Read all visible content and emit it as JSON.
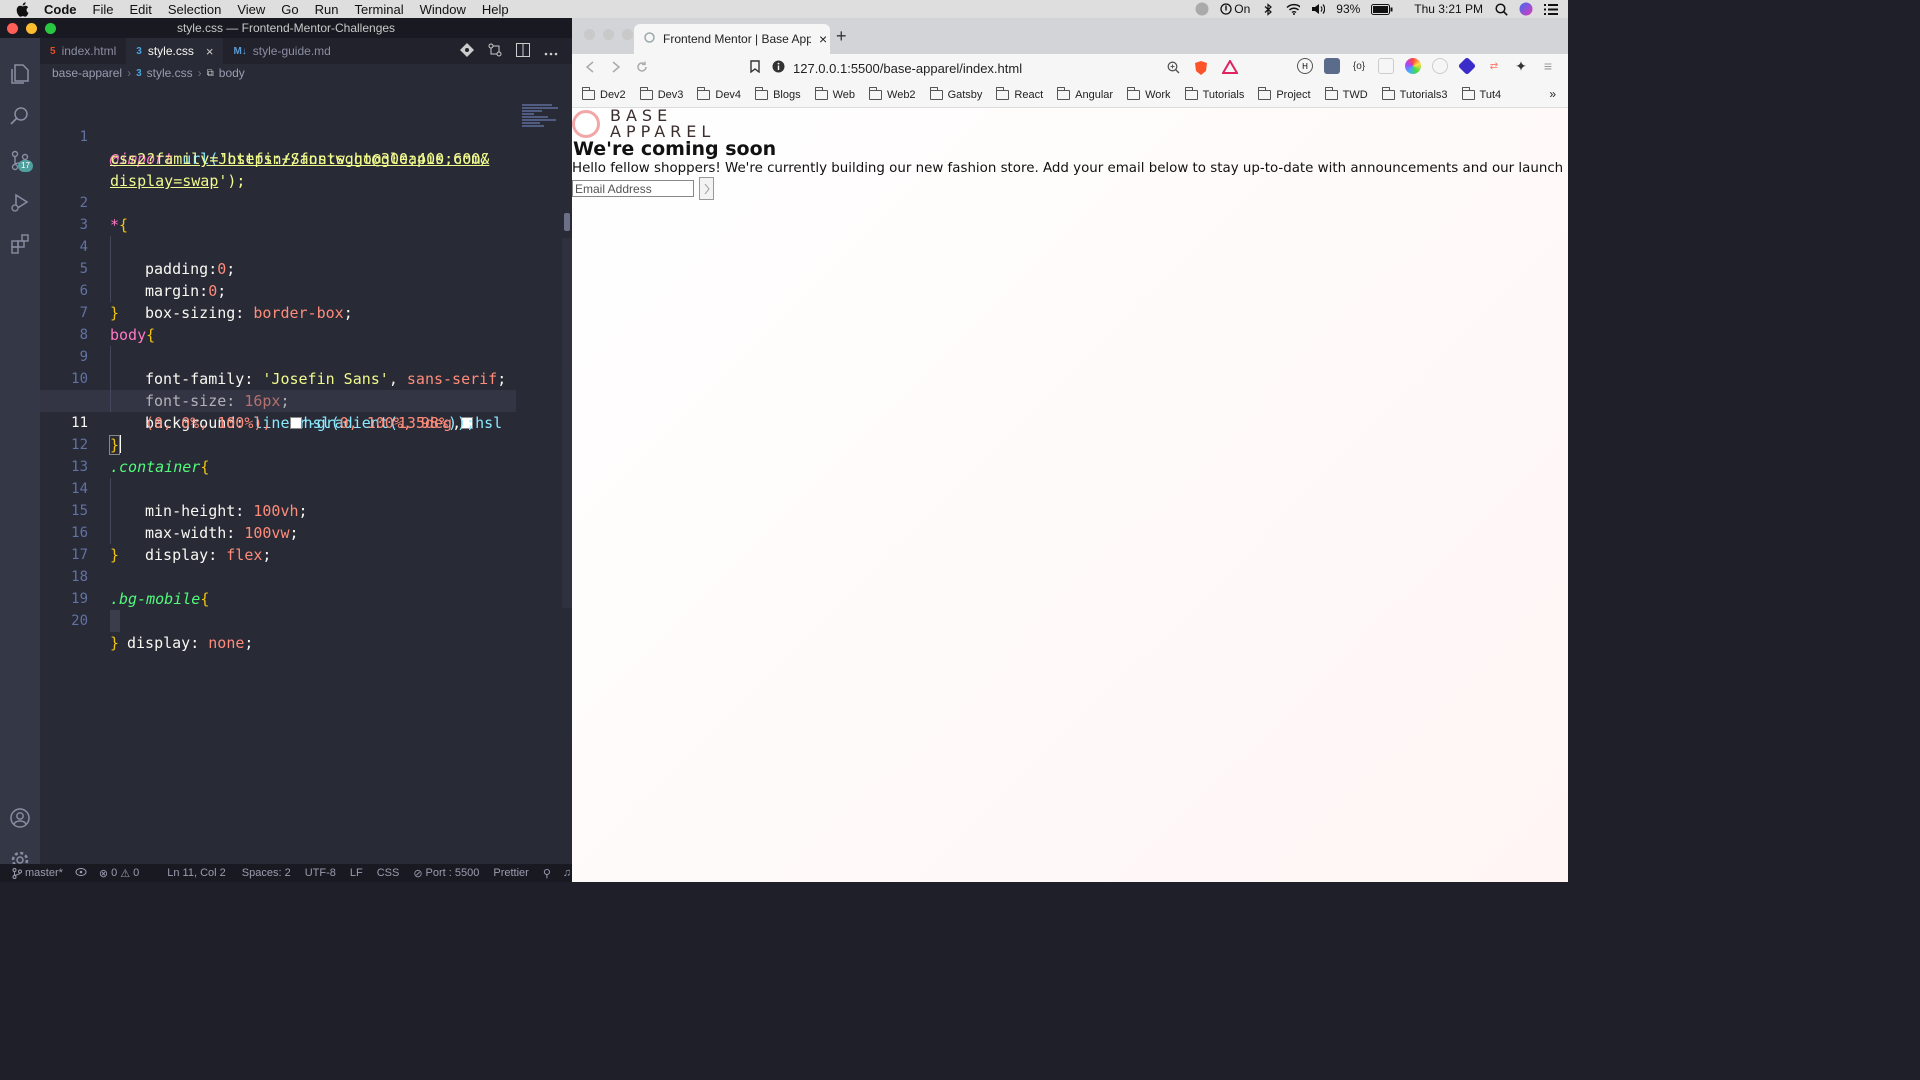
{
  "menubar": {
    "items": [
      "Code",
      "File",
      "Edit",
      "Selection",
      "View",
      "Go",
      "Run",
      "Terminal",
      "Window",
      "Help"
    ],
    "focus_label": "On",
    "battery": "93%",
    "clock": "Thu 3:21 PM"
  },
  "vscode": {
    "window_title": "style.css — Frontend-Mentor-Challenges",
    "scm_badge": "17",
    "tabs": [
      {
        "label": "index.html",
        "type": "html"
      },
      {
        "label": "style.css",
        "type": "css",
        "active": true
      },
      {
        "label": "style-guide.md",
        "type": "md"
      }
    ],
    "breadcrumb": [
      "base-apparel",
      "style.css",
      "body"
    ],
    "line_numbers": [
      "1",
      "2",
      "3",
      "4",
      "5",
      "6",
      "7",
      "8",
      "9",
      "10",
      "11",
      "12",
      "13",
      "14",
      "15",
      "16",
      "17",
      "18",
      "19",
      "20"
    ],
    "code": {
      "l1a_kw": "@import",
      "l1a_fn": "url(",
      "l1a_q": "'",
      "l1a_url": "https://fonts.googleapis.com/",
      "l1b_url": "css2?family=Josefin+Sans:wght@300;400;600&",
      "l1c_url": "display=swap",
      "l1c_end": "');",
      "l2_sel": "*",
      "l3_prop": "padding:",
      "l3_val": "0",
      "l4_prop": "margin:",
      "l4_val": "0",
      "l5_prop": "box-sizing: ",
      "l5_val": "border-box",
      "l7_sel": "body",
      "l8_prop": "font-family: ",
      "l8_str": "'Josefin Sans'",
      "l8_val": "sans-serif",
      "l9_prop": "font-size: ",
      "l9_val": "16px",
      "l10_prop": "background: ",
      "l10_fn": "linear-gradient(",
      "l10_deg": "135deg",
      "l10_hsl": "hsl",
      "l10b_args": "(0, 0%, 100%),",
      "l10b_hsl2": "hsl(",
      "l10b_args2": "0, 100%, 98%",
      "l10b_end": "));",
      "l12_sel": ".container",
      "l13_prop": "min-height: ",
      "l13_val": "100vh",
      "l14_prop": "max-width: ",
      "l14_val": "100vw",
      "l15_prop": "display: ",
      "l15_val": "flex",
      "l18_sel": ".bg-mobile",
      "l19_prop": "display: ",
      "l19_val": "none"
    },
    "status": {
      "branch": "master*",
      "errors": "0",
      "warnings": "0",
      "position": "Ln 11, Col 2",
      "spaces": "Spaces: 2",
      "encoding": "UTF-8",
      "eol": "LF",
      "language": "CSS",
      "port": "Port : 5500",
      "formatter": "Prettier"
    }
  },
  "browser": {
    "tab_title": "Frontend Mentor | Base Apparel",
    "url": "127.0.0.1:5500/base-apparel/index.html",
    "bookmarks": [
      "Dev2",
      "Dev3",
      "Dev4",
      "Blogs",
      "Web",
      "Web2",
      "Gatsby",
      "React",
      "Angular",
      "Work",
      "Tutorials",
      "Project",
      "TWD",
      "Tutorials3",
      "Tut4"
    ],
    "bookmarks_more": "»"
  },
  "page": {
    "logo_line1": "BASE",
    "logo_line2": "APPAREL",
    "heading": "We're coming soon",
    "lead": "Hello fellow shoppers! We're currently building our new fashion store. Add your email below to stay up-to-date with announcements and our launch deals.",
    "email_placeholder": "Email Address"
  },
  "colors": {
    "menubar_bg": "#dedede",
    "vscode_editor_bg": "#282a36",
    "vscode_activity_bg": "#343746",
    "accent_pink": "#ff79c6",
    "accent_yellow": "#f1fa8c",
    "logo_ring": "#f2a6a6",
    "page_gradient": [
      "hsl(0, 0%, 100%)",
      "hsl(0, 100%, 98%)"
    ]
  }
}
